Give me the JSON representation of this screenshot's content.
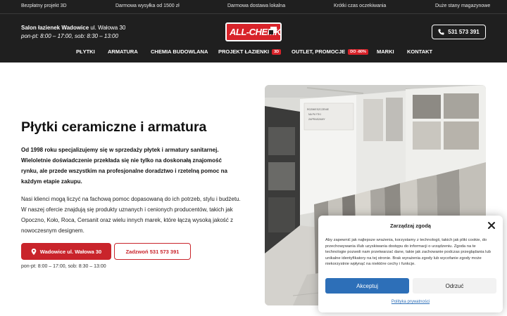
{
  "topbar": {
    "items": [
      "Bezpłatny projekt 3D",
      "Darmowa wysyłka od 1500 zł",
      "Darmowa dostawa lokalna",
      "Krótki czas oczekiwania",
      "Duże stany magazynowe"
    ]
  },
  "store": {
    "name": "Salon łazienek Wadowice",
    "address": " ul. Wałowa 30",
    "hours": "pon-pt: 8:00 – 17:00, sob: 8:30 – 13:00"
  },
  "logo": {
    "text": "ALL-CHEMK"
  },
  "phone": {
    "number": "531 573 391"
  },
  "nav": {
    "items": [
      {
        "label": "PŁYTKI"
      },
      {
        "label": "ARMATURA"
      },
      {
        "label": "CHEMIA BUDOWLANA"
      },
      {
        "label": "PROJEKT ŁAZIENKI",
        "badge": "3D"
      },
      {
        "label": "OUTLET, PROMOCJE",
        "badge": "DO -80%"
      },
      {
        "label": "MARKI"
      },
      {
        "label": "KONTAKT"
      }
    ]
  },
  "hero": {
    "title": "Płytki ceramiczne i armatura",
    "lead": "Od 1998 roku specjalizujemy się w sprzedaży płytek i armatury sanitarnej. Wieloletnie doświadczenie przekłada się nie tylko na doskonałą znajomość rynku, ale przede wszystkim na profesjonalne doradztwo i rzetelną pomoc na każdym etapie zakupu.",
    "body": "Nasi klienci mogą liczyć na fachową pomoc dopasowaną do ich potrzeb, stylu i budżetu. W naszej ofercie znajdują się produkty uznanych i cenionych producentów, takich jak Opoczno, Koło, Roca, Cersanit oraz wielu innych marek, które łączą wysoką jakość z nowoczesnym designem.",
    "address_button": "Wadowice ul. Wałowa 30",
    "call_button": "Zadzwoń 531 573 391",
    "hours": "pon-pt: 8:00 – 17:00, sob: 8:30 – 13:00"
  },
  "photo": {
    "sign_text": "ROZMIESZCZENIE NA PŁYTKI ZAPRASZAMY"
  },
  "cookie": {
    "title": "Zarządzaj zgodą",
    "text": "Aby zapewnić jak najlepsze wrażenia, korzystamy z technologii, takich jak pliki cookie, do przechowywania i/lub uzyskiwania dostępu do informacji o urządzeniu. Zgoda na te technologie pozwoli nam przetwarzać dane, takie jak zachowanie podczas przeglądania lub unikalne identyfikatory na tej stronie. Brak wyrażenia zgody lub wycofanie zgody może niekorzystnie wpłynąć na niektóre cechy i funkcje.",
    "accept": "Akceptuj",
    "reject": "Odrzuć",
    "privacy": "Polityka prywatności"
  },
  "colors": {
    "header_bg": "#1f1f1f",
    "brand_red": "#c9242b",
    "accept_blue": "#2d6fb8"
  }
}
